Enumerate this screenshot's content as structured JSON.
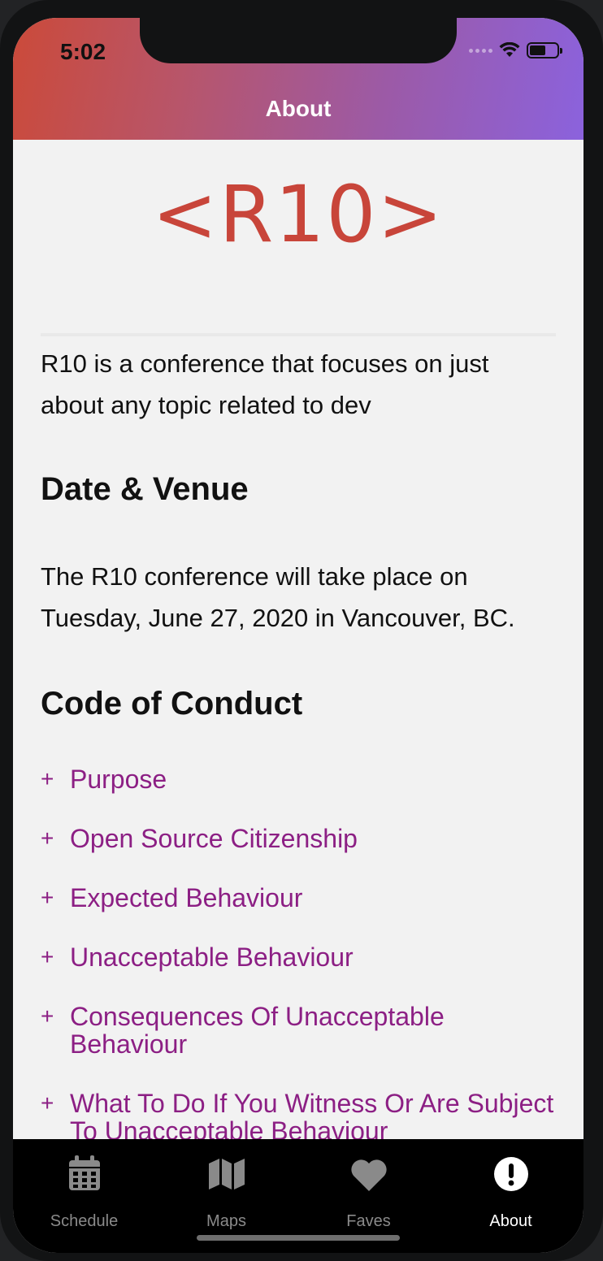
{
  "status_bar": {
    "time": "5:02"
  },
  "header": {
    "title": "About"
  },
  "logo": {
    "text": "<R10>"
  },
  "intro": {
    "text": "R10 is a conference that focuses on just about any topic related to dev"
  },
  "date_venue": {
    "heading": "Date & Venue",
    "text": "The R10 conference will take place on Tuesday, June 27, 2020 in Vancouver, BC."
  },
  "code_of_conduct": {
    "heading": "Code of Conduct",
    "items": [
      {
        "icon": "+",
        "label": "Purpose"
      },
      {
        "icon": "+",
        "label": "Open Source Citizenship"
      },
      {
        "icon": "+",
        "label": "Expected Behaviour"
      },
      {
        "icon": "+",
        "label": "Unacceptable Behaviour"
      },
      {
        "icon": "+",
        "label": "Consequences Of Unacceptable Behaviour"
      },
      {
        "icon": "+",
        "label": "What To Do If You Witness Or Are Subject To Unacceptable Behaviour"
      }
    ]
  },
  "tabbar": {
    "tabs": [
      {
        "label": "Schedule",
        "icon": "calendar-icon",
        "active": false
      },
      {
        "label": "Maps",
        "icon": "map-icon",
        "active": false
      },
      {
        "label": "Faves",
        "icon": "heart-icon",
        "active": false
      },
      {
        "label": "About",
        "icon": "info-icon",
        "active": true
      }
    ]
  },
  "colors": {
    "accent": "#8c1f84",
    "logo": "#c8453a",
    "header_gradient_start": "#cb4a3a",
    "header_gradient_end": "#8b62dd"
  }
}
